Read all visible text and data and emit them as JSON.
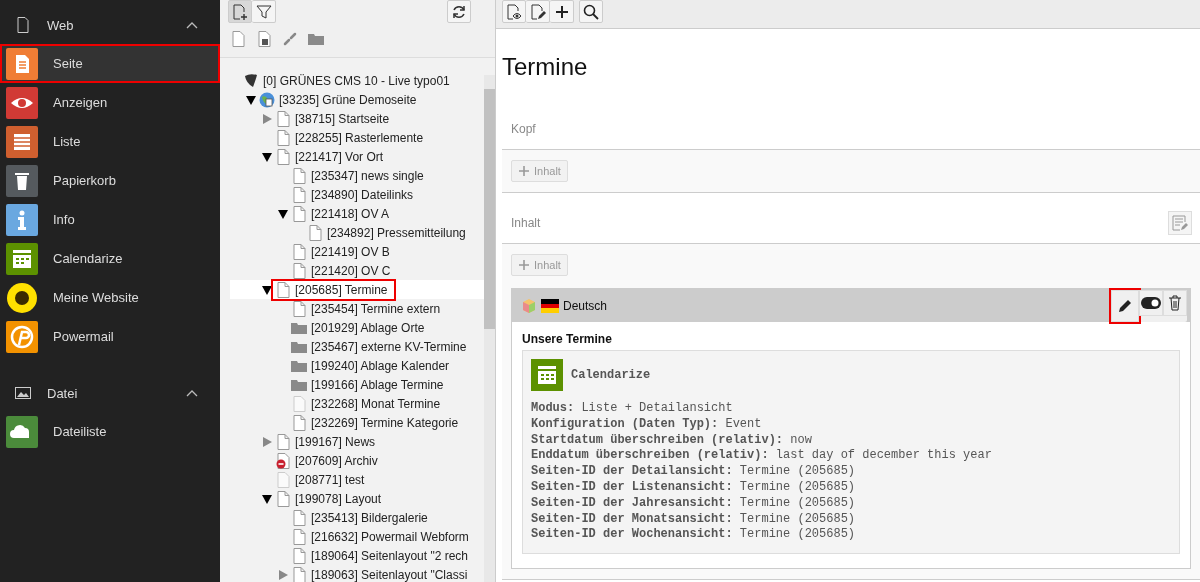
{
  "sidebar": {
    "groups": [
      {
        "title": "Web",
        "expanded": true,
        "items": [
          {
            "label": "Seite",
            "kind": "page",
            "color": "#f07d35",
            "selected": true,
            "highlighted": true
          },
          {
            "label": "Anzeigen",
            "kind": "eye",
            "color": "#d13a35",
            "selected": false,
            "highlighted": false
          },
          {
            "label": "Liste",
            "kind": "list",
            "color": "#cf5f2f",
            "selected": false,
            "highlighted": false
          },
          {
            "label": "Papierkorb",
            "kind": "trash",
            "color": "#555a5e",
            "selected": false,
            "highlighted": false
          },
          {
            "label": "Info",
            "kind": "info",
            "color": "#6aa8e0",
            "selected": false,
            "highlighted": false
          },
          {
            "label": "Calendarize",
            "kind": "calendar",
            "color": "#5c9100",
            "selected": false,
            "highlighted": false
          },
          {
            "label": "Meine Website",
            "kind": "sunflower",
            "color": "#ffe000",
            "selected": false,
            "highlighted": false
          },
          {
            "label": "Powermail",
            "kind": "powermail",
            "color": "#f39200",
            "selected": false,
            "highlighted": false
          }
        ]
      },
      {
        "title": "Datei",
        "expanded": true,
        "items": [
          {
            "label": "Dateiliste",
            "kind": "cloud",
            "color": "#4b8b3b",
            "selected": false,
            "highlighted": false
          }
        ]
      }
    ]
  },
  "tree": {
    "root": {
      "label": "[0] GRÜNES CMS 10 - Live typo01",
      "kind": "root",
      "selected": false,
      "children": [
        {
          "label": "[33235] Grüne Demoseite",
          "kind": "globe",
          "expanded": true,
          "selected": false,
          "children": [
            {
              "label": "[38715] Startseite",
              "kind": "page",
              "expanded": false,
              "selected": false
            },
            {
              "label": "[228255] Rasterlemente",
              "kind": "page",
              "selected": false
            },
            {
              "label": "[221417] Vor Ort",
              "kind": "page",
              "expanded": true,
              "selected": false,
              "children": [
                {
                  "label": "[235347] news single",
                  "kind": "page",
                  "selected": false
                },
                {
                  "label": "[234890] Dateilinks",
                  "kind": "page",
                  "selected": false
                },
                {
                  "label": "[221418] OV A",
                  "kind": "page",
                  "expanded": true,
                  "selected": false,
                  "children": [
                    {
                      "label": "[234892] Pressemitteilung",
                      "kind": "page",
                      "selected": false
                    }
                  ]
                },
                {
                  "label": "[221419] OV B",
                  "kind": "page",
                  "selected": false
                },
                {
                  "label": "[221420] OV C",
                  "kind": "page",
                  "selected": false
                }
              ]
            },
            {
              "label": "[205685] Termine",
              "kind": "page",
              "expanded": true,
              "selected": true,
              "highlighted": true,
              "children": [
                {
                  "label": "[235454] Termine extern",
                  "kind": "page",
                  "selected": false
                },
                {
                  "label": "[201929] Ablage Orte",
                  "kind": "folder",
                  "selected": false
                },
                {
                  "label": "[235467] externe KV-Termine",
                  "kind": "folder",
                  "selected": false
                },
                {
                  "label": "[199240] Ablage Kalender",
                  "kind": "folder",
                  "selected": false
                },
                {
                  "label": "[199166] Ablage Termine",
                  "kind": "folder",
                  "selected": false
                },
                {
                  "label": "[232268] Monat Termine",
                  "kind": "page-hidden",
                  "selected": false
                },
                {
                  "label": "[232269] Termine Kategorie",
                  "kind": "page",
                  "selected": false
                }
              ]
            },
            {
              "label": "[199167] News",
              "kind": "page",
              "expanded": false,
              "selected": false
            },
            {
              "label": "[207609] Archiv",
              "kind": "page-blocked",
              "selected": false
            },
            {
              "label": "[208771] test",
              "kind": "page-hidden",
              "selected": false
            },
            {
              "label": "[199078] Layout",
              "kind": "page",
              "expanded": true,
              "selected": false,
              "children": [
                {
                  "label": "[235413] Bildergalerie",
                  "kind": "page",
                  "selected": false
                },
                {
                  "label": "[216632] Powermail Webform",
                  "kind": "page",
                  "selected": false
                },
                {
                  "label": "[189064] Seitenlayout \"2 rech",
                  "kind": "page",
                  "selected": false
                },
                {
                  "label": "[189063] Seitenlayout \"Classi",
                  "kind": "page",
                  "expanded": false,
                  "selected": false
                }
              ]
            }
          ]
        }
      ]
    }
  },
  "main": {
    "title": "Termine",
    "sections": [
      {
        "label": "Kopf",
        "add_button": "Inhalt",
        "edit_icon": false
      },
      {
        "label": "Inhalt",
        "add_button": "Inhalt",
        "edit_icon": true,
        "elements": [
          {
            "language": "Deutsch",
            "edit_highlighted": true,
            "header": "Unsere Termine",
            "plugin": "Calendarize",
            "fields": [
              {
                "label": "Modus:",
                "value": "Liste + Detailansicht"
              },
              {
                "label": "Konfiguration (Daten Typ):",
                "value": "Event"
              },
              {
                "label": "Startdatum überschreiben (relativ):",
                "value": "now"
              },
              {
                "label": "Enddatum überschreiben (relativ):",
                "value": "last day of december this year"
              },
              {
                "label": "Seiten-ID der Detailansicht:",
                "value": "Termine (205685)"
              },
              {
                "label": "Seiten-ID der Listenansicht:",
                "value": "Termine (205685)"
              },
              {
                "label": "Seiten-ID der Jahresansicht:",
                "value": "Termine (205685)"
              },
              {
                "label": "Seiten-ID der Monatsansicht:",
                "value": "Termine (205685)"
              },
              {
                "label": "Seiten-ID der Wochenansicht:",
                "value": "Termine (205685)"
              }
            ]
          }
        ]
      }
    ]
  }
}
